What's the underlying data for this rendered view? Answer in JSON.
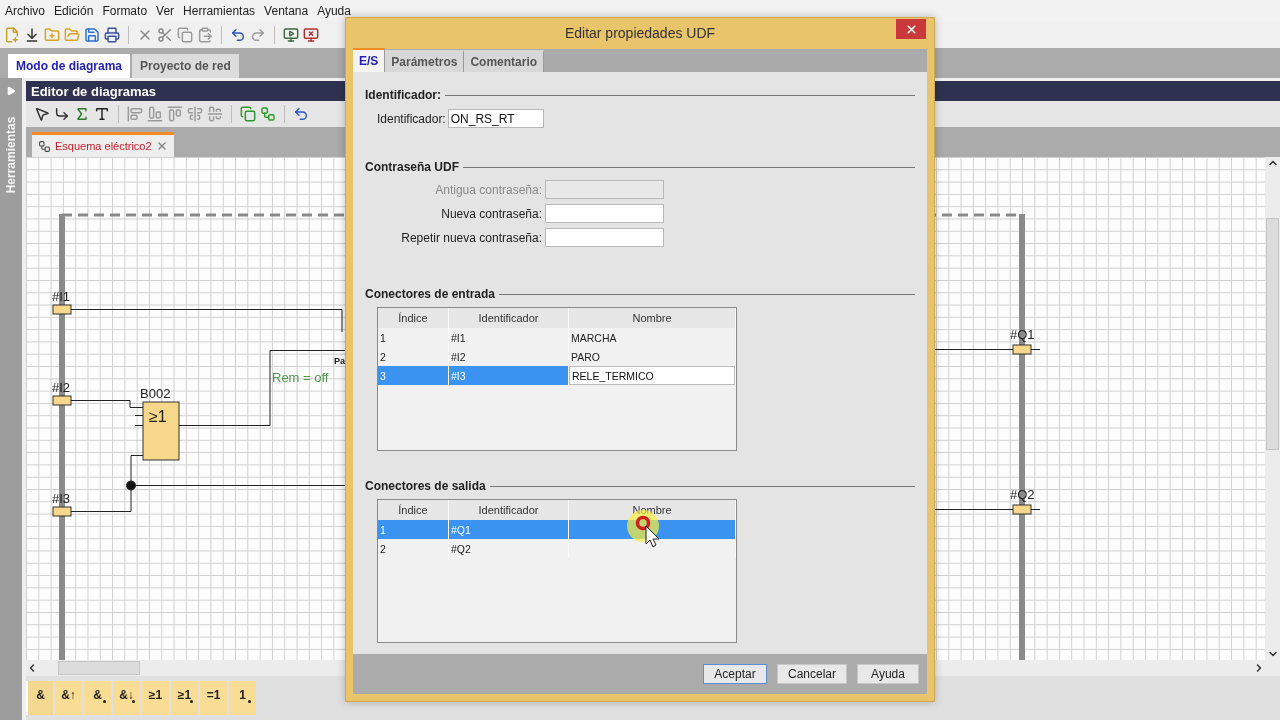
{
  "menu": [
    {
      "label": "Archivo"
    },
    {
      "label": "Edición"
    },
    {
      "label": "Formato"
    },
    {
      "label": "Ver"
    },
    {
      "label": "Herramientas"
    },
    {
      "label": "Ventana"
    },
    {
      "label": "Ayuda"
    }
  ],
  "mode_tabs": [
    {
      "label": "Modo de diagrama",
      "selected": true
    },
    {
      "label": "Proyecto de red",
      "selected": false
    }
  ],
  "side_panel": {
    "label": "Herramientas"
  },
  "editor": {
    "title": "Editor de diagramas",
    "document_tab": {
      "label": "Esquema eléctrico2",
      "selected": true
    }
  },
  "diagram": {
    "inputs": [
      {
        "label": "#I1"
      },
      {
        "label": "#I2"
      },
      {
        "label": "#I3"
      }
    ],
    "block": {
      "name": "B002",
      "symbol": "≥1"
    },
    "block_parameter": "Rem = off",
    "cut_label": "Pa",
    "outputs": [
      {
        "label": "#Q1"
      },
      {
        "label": "#Q2"
      }
    ]
  },
  "palette": [
    {
      "symbol": "&",
      "negated": false,
      "selected": true
    },
    {
      "symbol": "&↑",
      "negated": false,
      "selected": false
    },
    {
      "symbol": "&",
      "negated": true,
      "selected": false
    },
    {
      "symbol": "&↓",
      "negated": true,
      "selected": false
    },
    {
      "symbol": "≥1",
      "negated": false,
      "selected": false
    },
    {
      "symbol": "≥1",
      "negated": true,
      "selected": false
    },
    {
      "symbol": "=1",
      "negated": false,
      "selected": false
    },
    {
      "symbol": "1",
      "negated": true,
      "selected": false
    }
  ],
  "dialog": {
    "title": "Editar propiedades UDF",
    "tabs": [
      {
        "label": "E/S",
        "selected": true
      },
      {
        "label": "Parámetros",
        "selected": false
      },
      {
        "label": "Comentario",
        "selected": false
      }
    ],
    "identifier_section": {
      "heading": "Identificador:",
      "label": "Identificador:",
      "value": "ON_RS_RT"
    },
    "password_section": {
      "heading": "Contraseña UDF",
      "fields": [
        {
          "label": "Antigua contraseña:",
          "disabled": true
        },
        {
          "label": "Nueva contraseña:",
          "disabled": false
        },
        {
          "label": "Repetir nueva contraseña:",
          "disabled": false
        }
      ]
    },
    "input_connectors": {
      "heading": "Conectores de entrada",
      "columns": [
        "Índice",
        "Identificador",
        "Nombre"
      ],
      "rows": [
        {
          "index": "1",
          "identifier": "#I1",
          "name": "MARCHA",
          "selected": false,
          "editing": false
        },
        {
          "index": "2",
          "identifier": "#I2",
          "name": "PARO",
          "selected": false,
          "editing": false
        },
        {
          "index": "3",
          "identifier": "#I3",
          "name": "RELE_TERMICO",
          "selected": true,
          "editing": true
        }
      ]
    },
    "output_connectors": {
      "heading": "Conectores de salida",
      "columns": [
        "Índice",
        "Identificador",
        "Nombre"
      ],
      "rows": [
        {
          "index": "1",
          "identifier": "#Q1",
          "selected": true,
          "editing": false
        },
        {
          "index": "2",
          "identifier": "#Q2",
          "selected": false,
          "editing": false
        }
      ]
    },
    "buttons": [
      {
        "label": "Aceptar",
        "default": true
      },
      {
        "label": "Cancelar",
        "default": false
      },
      {
        "label": "Ayuda",
        "default": false
      }
    ]
  }
}
